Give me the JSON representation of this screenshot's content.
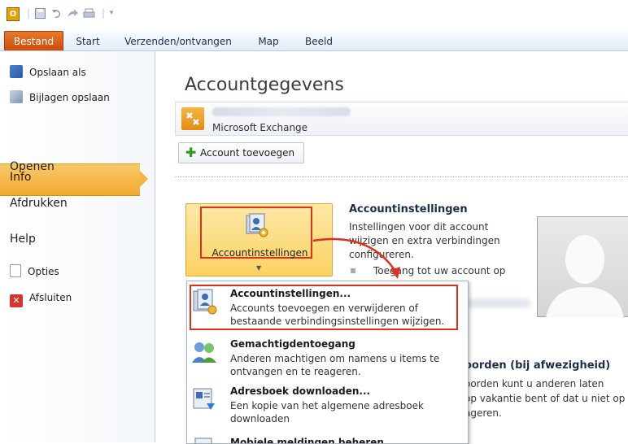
{
  "quick_access": {
    "app_icon": "O",
    "icons": [
      "save-icon",
      "undo-icon",
      "send-icon",
      "print-icon",
      "customize-icon"
    ],
    "separator": "|"
  },
  "ribbon_tabs": [
    "Bestand",
    "Start",
    "Verzenden/ontvangen",
    "Map",
    "Beeld"
  ],
  "backstage": {
    "items": [
      {
        "label": "Opslaan als",
        "icon": "save-as-icon"
      },
      {
        "label": "Bijlagen opslaan",
        "icon": "save-attachments-icon"
      },
      {
        "label": "Info"
      },
      {
        "label": "Openen"
      },
      {
        "label": "Afdrukken"
      },
      {
        "label": "Help"
      },
      {
        "label": "Opties",
        "icon": "options-icon"
      },
      {
        "label": "Afsluiten",
        "icon": "exit-icon"
      }
    ],
    "selected": "Info"
  },
  "main": {
    "title": "Accountgegevens",
    "account_type": "Microsoft Exchange",
    "add_account": "Account toevoegen",
    "account_settings_button": "Accountinstellingen",
    "settings_title": "Accountinstellingen",
    "settings_desc": "Instellingen voor dit account wijzigen en extra verbindingen configureren.",
    "settings_bullet": "Toegang tot uw account op",
    "oof_title": "oorden (bij afwezigheid)",
    "oof_desc_1": "oorden kunt u anderen laten",
    "oof_desc_2": "op vakantie bent of dat u niet op",
    "oof_desc_3": "ageren."
  },
  "menu": {
    "items": [
      {
        "title": "Accountinstellingen...",
        "desc": "Accounts toevoegen en verwijderen of bestaande verbindingsinstellingen wijzigen.",
        "icon": "account-settings-icon"
      },
      {
        "title": "Gemachtigdentoegang",
        "desc": "Anderen machtigen om namens u items te ontvangen en te reageren.",
        "icon": "delegate-access-icon"
      },
      {
        "title": "Adresboek downloaden...",
        "desc": "Een kopie van het algemene adresboek downloaden",
        "icon": "address-book-icon"
      },
      {
        "title": "Mobiele meldingen beheren",
        "desc": "",
        "icon": "mobile-notifications-icon"
      }
    ]
  },
  "colors": {
    "file_tab": "#d9601a",
    "selected": "#f4b543",
    "highlight": "#e0301e"
  }
}
